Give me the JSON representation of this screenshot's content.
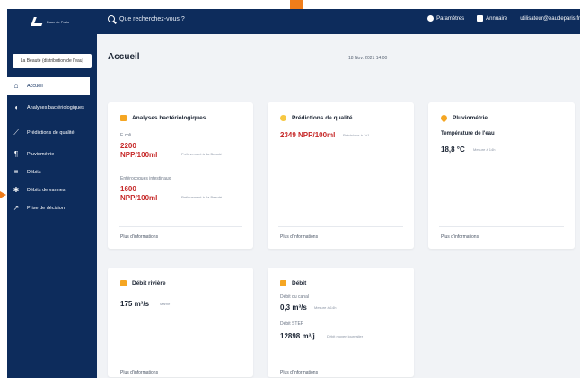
{
  "topbar": {
    "logo_text": "Eaux de Paris",
    "search_placeholder": "Que recherchez-vous ?",
    "links": [
      {
        "label": "Paramètres",
        "icon": "gear-icon"
      },
      {
        "label": "Annuaire",
        "icon": "book-icon"
      },
      {
        "label": "utilisateur@eaudeparis.fr",
        "icon": ""
      }
    ]
  },
  "sidebar": {
    "select_label": "La Beauté (distribution de l'eau)",
    "items": [
      {
        "label": "Accueil",
        "icon": "home-icon"
      },
      {
        "label": "Analyses bactériologiques",
        "icon": "bacteria-icon"
      },
      {
        "label": "Prédictions de qualité",
        "icon": "chart-icon"
      },
      {
        "label": "Pluviométrie",
        "icon": "rain-icon"
      },
      {
        "label": "Débits",
        "icon": "list-icon"
      },
      {
        "label": "Débits de vannes",
        "icon": "gear-icon"
      },
      {
        "label": "Prise de décision",
        "icon": "decision-icon"
      }
    ]
  },
  "main": {
    "title": "Accueil",
    "date": "18 Nov. 2021 14:00",
    "more_label": "Plus d'informations",
    "cards": {
      "bacterio": {
        "title": "Analyses bactériologiques",
        "label1": "E.coli",
        "value1": "2200 NPP/100ml",
        "note1": "Prélèvement à La Beauté",
        "label2": "Entérocoques intestinaux",
        "value2": "1600 NPP/100ml",
        "note2": "Prélèvement à La Beauté"
      },
      "prediction": {
        "title": "Prédictions de qualité",
        "value": "2349 NPP/100ml",
        "note": "Prévisions à J+1"
      },
      "pluvio": {
        "title": "Pluviométrie",
        "subtitle": "Température de l'eau",
        "value": "18,8 °C",
        "note": "Mesure à 14h"
      },
      "debit_rivieres": {
        "title": "Débit rivière",
        "value": "175 m³/s",
        "note": "Marne"
      },
      "debit": {
        "title": "Débit",
        "label1": "Débit du canal",
        "value1": "0,3 m³/s",
        "note1": "Mesure à 14h",
        "label2": "Débit STEP",
        "value2": "12898 m³/j",
        "note2": "Débit moyen journalier"
      }
    }
  }
}
